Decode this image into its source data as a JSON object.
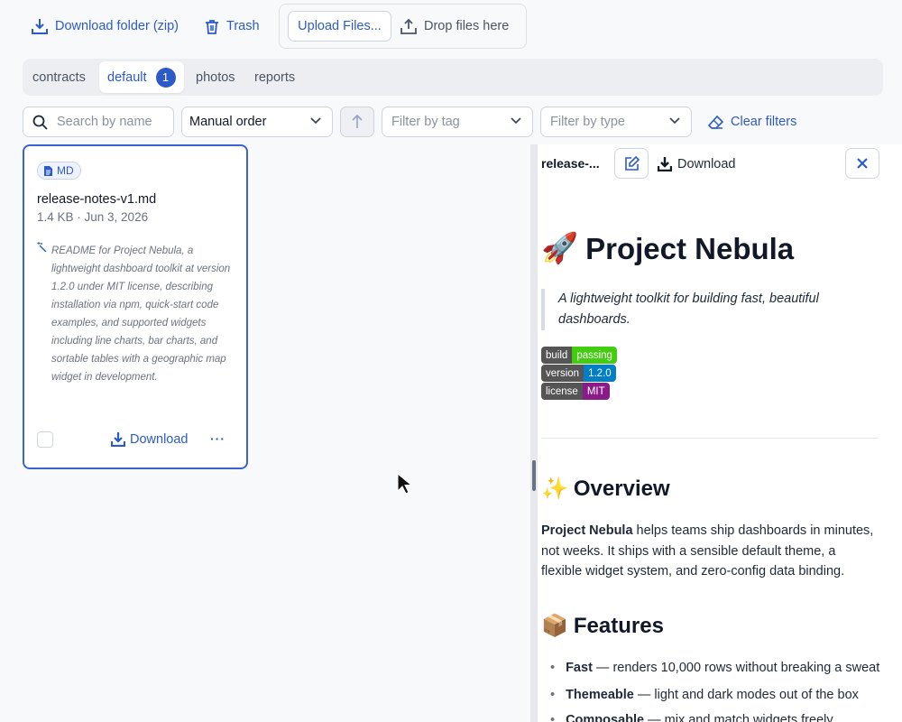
{
  "toolbar": {
    "download_folder_label": "Download folder (zip)",
    "trash_label": "Trash",
    "upload_label": "Upload Files...",
    "drop_label": "Drop files here"
  },
  "tabs": [
    {
      "label": "contracts",
      "active": false
    },
    {
      "label": "default",
      "active": true,
      "count": "1"
    },
    {
      "label": "photos",
      "active": false
    },
    {
      "label": "reports",
      "active": false
    }
  ],
  "filters": {
    "search_placeholder": "Search by name",
    "sort_value": "Manual order",
    "tag_placeholder": "Filter by tag",
    "type_placeholder": "Filter by type",
    "clear_label": "Clear filters"
  },
  "card": {
    "type_badge": "MD",
    "name": "release-notes-v1.md",
    "meta": "1.4 KB · Jun 3, 2026",
    "summary": "README for Project Nebula, a lightweight dashboard toolkit at version 1.2.0 under MIT license, describing installation via npm, quick-start code examples, and supported widgets including line charts, bar charts, and sortable tables with a geographic map widget in development.",
    "download_label": "Download",
    "more_label": "···"
  },
  "preview": {
    "title": "release-...",
    "download_label": "Download",
    "h1_emoji": "🚀",
    "h1": "Project Nebula",
    "tagline": "A lightweight toolkit for building fast, beautiful dashboards.",
    "badges": [
      {
        "key": "build",
        "value": "passing",
        "color": "#4c1"
      },
      {
        "key": "version",
        "value": "1.2.0",
        "color": "#007ec6"
      },
      {
        "key": "license",
        "value": "MIT",
        "color": "#8b1a89"
      }
    ],
    "overview_emoji": "✨",
    "overview_heading": "Overview",
    "overview_bold": "Project Nebula",
    "overview_text": " helps teams ship dashboards in minutes, not weeks. It ships with a sensible default theme, a flexible widget system, and zero-config data binding.",
    "features_emoji": "📦",
    "features_heading": "Features",
    "features": [
      {
        "bold": "Fast",
        "text": " — renders 10,000 rows without breaking a sweat"
      },
      {
        "bold": "Themeable",
        "text": " — light and dark modes out of the box"
      },
      {
        "bold": "Composable",
        "text": " — mix and match widgets freely"
      }
    ]
  }
}
